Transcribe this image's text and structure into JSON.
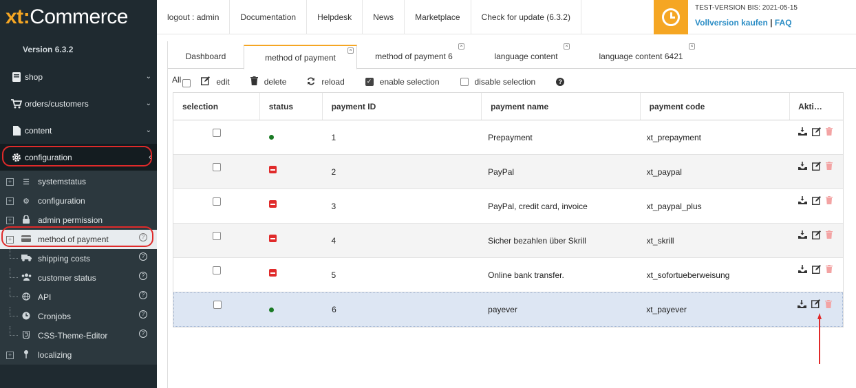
{
  "logo": {
    "xt": "xt",
    "colon": ":",
    "commerce": "Commerce"
  },
  "version": "Version 6.3.2",
  "sidebar": {
    "menu": [
      {
        "label": "shop",
        "icon": "book-icon"
      },
      {
        "label": "orders/customers",
        "icon": "cart-icon"
      },
      {
        "label": "content",
        "icon": "file-icon"
      },
      {
        "label": "configuration",
        "icon": "gear-icon"
      }
    ],
    "tree": [
      {
        "label": "systemstatus",
        "icon": "list-icon",
        "help": false,
        "plus": true
      },
      {
        "label": "configuration",
        "icon": "gear-icon",
        "help": false,
        "plus": true
      },
      {
        "label": "admin permission",
        "icon": "lock-icon",
        "help": false,
        "plus": true
      },
      {
        "label": "method of payment",
        "icon": "credit-card-icon",
        "help": true,
        "plus": true
      },
      {
        "label": "shipping costs",
        "icon": "truck-icon",
        "help": true,
        "plus": false
      },
      {
        "label": "customer status",
        "icon": "users-icon",
        "help": true,
        "plus": false
      },
      {
        "label": "API",
        "icon": "globe-icon",
        "help": true,
        "plus": false
      },
      {
        "label": "Cronjobs",
        "icon": "clock-icon",
        "help": true,
        "plus": false
      },
      {
        "label": "CSS-Theme-Editor",
        "icon": "css-icon",
        "help": true,
        "plus": false
      },
      {
        "label": "localizing",
        "icon": "pin-icon",
        "help": false,
        "plus": true
      }
    ]
  },
  "topnav": [
    "logout : admin",
    "Documentation",
    "Helpdesk",
    "News",
    "Marketplace",
    "Check for update (6.3.2)"
  ],
  "trial": {
    "text": "TEST-VERSION BIS: 2021-05-15",
    "buy": "Vollversion kaufen",
    "sep": "|",
    "faq": "FAQ"
  },
  "tabs": [
    "Dashboard",
    "method of payment",
    "method of payment 6",
    "language content",
    "language content 6421"
  ],
  "toolbar": {
    "all": "All",
    "edit": "edit",
    "delete": "delete",
    "reload": "reload",
    "enable": "enable selection",
    "disable": "disable selection",
    "help": "?"
  },
  "grid": {
    "columns": [
      "selection",
      "status",
      "payment ID",
      "payment name",
      "payment code",
      "Akti…"
    ],
    "rows": [
      {
        "status": "active",
        "id": "1",
        "name": "Prepayment",
        "code": "xt_prepayment"
      },
      {
        "status": "inactive",
        "id": "2",
        "name": "PayPal",
        "code": "xt_paypal"
      },
      {
        "status": "inactive",
        "id": "3",
        "name": "PayPal, credit card, invoice",
        "code": "xt_paypal_plus"
      },
      {
        "status": "inactive",
        "id": "4",
        "name": "Sicher bezahlen über Skrill",
        "code": "xt_skrill"
      },
      {
        "status": "inactive",
        "id": "5",
        "name": "Online bank transfer.",
        "code": "xt_sofortueberweisung"
      },
      {
        "status": "active",
        "id": "6",
        "name": "payever",
        "code": "xt_payever"
      }
    ]
  },
  "colors": {
    "accent": "#f5a623",
    "sidebar": "#1f2a30",
    "highlight": "#e02a2a",
    "link": "#2b8dc5"
  }
}
